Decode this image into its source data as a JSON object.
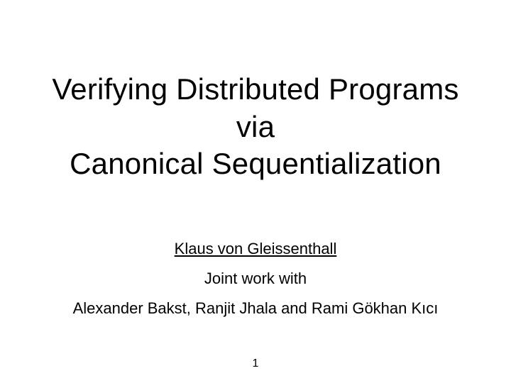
{
  "title": {
    "line1": "Verifying  Distributed Programs",
    "line2": "via",
    "line3": "Canonical Sequentialization"
  },
  "credits": {
    "presenter": "Klaus von Gleissenthall",
    "joint": "Joint work with",
    "coauthors": "Alexander Bakst, Ranjit Jhala and Rami Gökhan Kıcı"
  },
  "page": "1"
}
